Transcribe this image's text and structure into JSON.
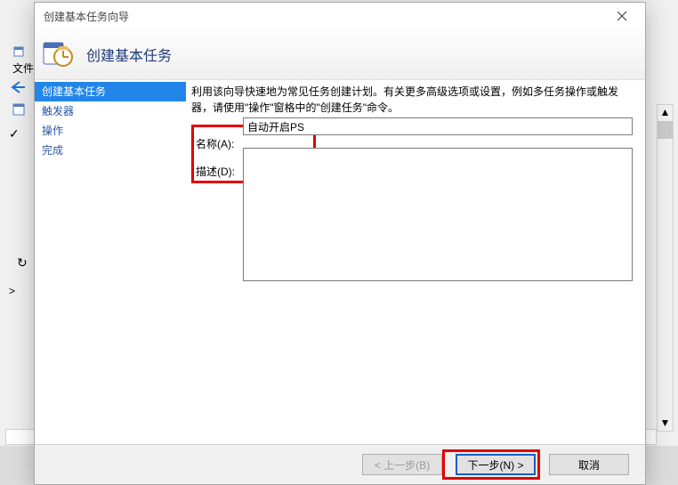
{
  "bg": {
    "file_label": "文件",
    "checkmark": "✓",
    "refresh": "↻",
    "expand": ">",
    "scroll_up": "▲",
    "scroll_down": "▼",
    "scroll_right": "▶"
  },
  "window": {
    "title": "创建基本任务向导",
    "header": "创建基本任务",
    "intro_line1": "利用该向导快速地为常见任务创建计划。有关更多高级选项或设置，例如多任务操作或触发",
    "intro_line2": "器，请使用\"操作\"窗格中的\"创建任务\"命令。"
  },
  "steps": [
    {
      "label": "创建基本任务",
      "active": true
    },
    {
      "label": "触发器",
      "active": false
    },
    {
      "label": "操作",
      "active": false
    },
    {
      "label": "完成",
      "active": false
    }
  ],
  "form": {
    "name_label": "名称(A):",
    "name_value": "自动开启PS",
    "desc_label": "描述(D):",
    "desc_value": ""
  },
  "buttons": {
    "back": "< 上一步(B)",
    "next": "下一步(N) >",
    "cancel": "取消"
  }
}
